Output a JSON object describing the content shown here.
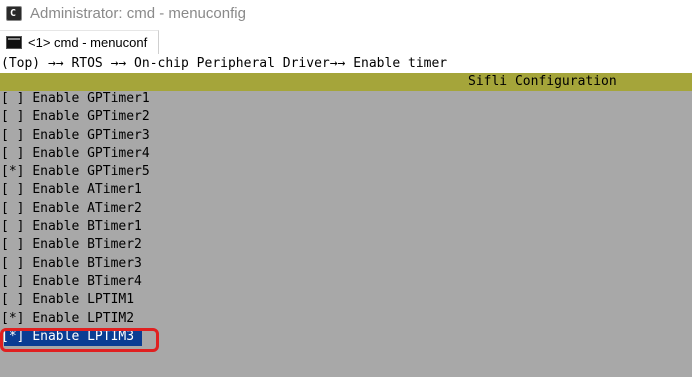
{
  "window": {
    "app_icon_glyph": "C",
    "title": "Administrator: cmd - menuconfig"
  },
  "tab": {
    "icon": "console-icon",
    "label": "<1> cmd - menuconf"
  },
  "console": {
    "breadcrumb": "(Top) →→ RTOS →→ On-chip Peripheral Driver→→ Enable timer",
    "header_title": "Sifli Configuration",
    "colors": {
      "background": "#a8a8a8",
      "header_bar": "#a5a53a",
      "selection": "#0a3d93",
      "highlight_box": "#e02020"
    },
    "items": [
      {
        "checkbox": "[ ]",
        "label": "Enable GPTimer1",
        "checked": false
      },
      {
        "checkbox": "[ ]",
        "label": "Enable GPTimer2",
        "checked": false
      },
      {
        "checkbox": "[ ]",
        "label": "Enable GPTimer3",
        "checked": false
      },
      {
        "checkbox": "[ ]",
        "label": "Enable GPTimer4",
        "checked": false
      },
      {
        "checkbox": "[*]",
        "label": "Enable GPTimer5",
        "checked": true
      },
      {
        "checkbox": "[ ]",
        "label": "Enable ATimer1",
        "checked": false
      },
      {
        "checkbox": "[ ]",
        "label": "Enable ATimer2",
        "checked": false
      },
      {
        "checkbox": "[ ]",
        "label": "Enable BTimer1",
        "checked": false
      },
      {
        "checkbox": "[ ]",
        "label": "Enable BTimer2",
        "checked": false
      },
      {
        "checkbox": "[ ]",
        "label": "Enable BTimer3",
        "checked": false
      },
      {
        "checkbox": "[ ]",
        "label": "Enable BTimer4",
        "checked": false
      },
      {
        "checkbox": "[ ]",
        "label": "Enable LPTIM1",
        "checked": false
      },
      {
        "checkbox": "[*]",
        "label": "Enable LPTIM2",
        "checked": true
      },
      {
        "checkbox": "[*]",
        "label": "Enable LPTIM3",
        "checked": true,
        "selected": true
      }
    ]
  }
}
